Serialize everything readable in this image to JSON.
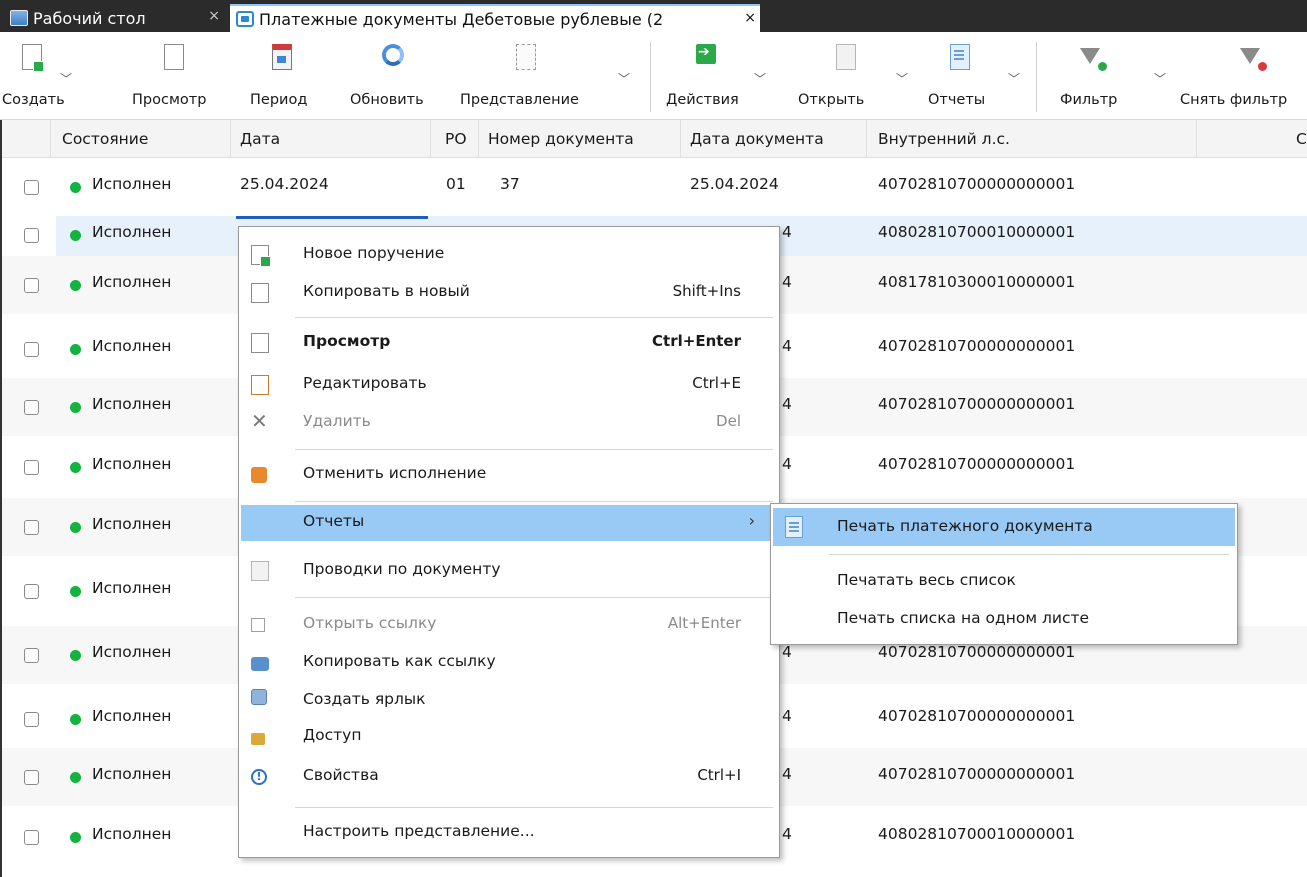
{
  "tabs": [
    {
      "label": "Рабочий стол",
      "close": "×",
      "icon": "desktop-icon"
    },
    {
      "label": "Платежные документы Дебетовые рублевые (2",
      "close": "×",
      "icon": "documents-icon"
    }
  ],
  "toolbar": {
    "create": "Создать",
    "view": "Просмотр",
    "period": "Период",
    "refresh": "Обновить",
    "representation": "Представление",
    "actions": "Действия",
    "open": "Открыть",
    "reports": "Отчеты",
    "filter": "Фильтр",
    "clear_filter": "Снять фильтр"
  },
  "columns": {
    "state": "Состояние",
    "date": "Дата",
    "ro": "РО",
    "doc_number": "Номер документа",
    "doc_date": "Дата документа",
    "internal_account": "Внутренний л.с.",
    "extra": "С"
  },
  "rows": [
    {
      "state": "Исполнен",
      "date": "25.04.2024",
      "ro": "01",
      "number": "37",
      "doc_date": "25.04.2024",
      "account": "40702810700000000001"
    },
    {
      "state": "Исполнен",
      "doc_date_frag": "4",
      "account": "40802810700010000001"
    },
    {
      "state": "Исполнен",
      "doc_date_frag": "4",
      "account": "40817810300010000001"
    },
    {
      "state": "Исполнен",
      "doc_date_frag": "4",
      "account": "40702810700000000001"
    },
    {
      "state": "Исполнен",
      "doc_date_frag": "4",
      "account": "40702810700000000001"
    },
    {
      "state": "Исполнен",
      "doc_date_frag": "4",
      "account": "40702810700000000001"
    },
    {
      "state": "Исполнен"
    },
    {
      "state": "Исполнен"
    },
    {
      "state": "Исполнен",
      "doc_date_frag": "4",
      "account": "40702810700000000001"
    },
    {
      "state": "Исполнен",
      "doc_date_frag": "4",
      "account": "40702810700000000001"
    },
    {
      "state": "Исполнен",
      "doc_date_frag": "4",
      "account": "40702810700000000001"
    },
    {
      "state": "Исполнен",
      "doc_date_frag": "4",
      "account": "40802810700010000001"
    }
  ],
  "context_menu": {
    "new_order": "Новое поручение",
    "copy_to_new": "Копировать в новый",
    "copy_to_new_sc": "Shift+Ins",
    "view": "Просмотр",
    "view_sc": "Ctrl+Enter",
    "edit": "Редактировать",
    "edit_sc": "Ctrl+E",
    "delete": "Удалить",
    "delete_sc": "Del",
    "cancel_execution": "Отменить исполнение",
    "reports": "Отчеты",
    "reports_arrow": "›",
    "postings": "Проводки по документу",
    "open_link": "Открыть ссылку",
    "open_link_sc": "Alt+Enter",
    "copy_as_link": "Копировать как ссылку",
    "create_shortcut": "Создать ярлык",
    "access": "Доступ",
    "properties": "Свойства",
    "properties_sc": "Ctrl+I",
    "customize_view": "Настроить представление..."
  },
  "submenu": {
    "print_payment_doc": "Печать платежного документа",
    "print_whole_list": "Печатать весь список",
    "print_list_one_sheet": "Печать списка на одном листе"
  },
  "colors": {
    "status_green": "#12b33e",
    "highlight": "#99c9f5",
    "tabbar": "#2b2b2b"
  }
}
